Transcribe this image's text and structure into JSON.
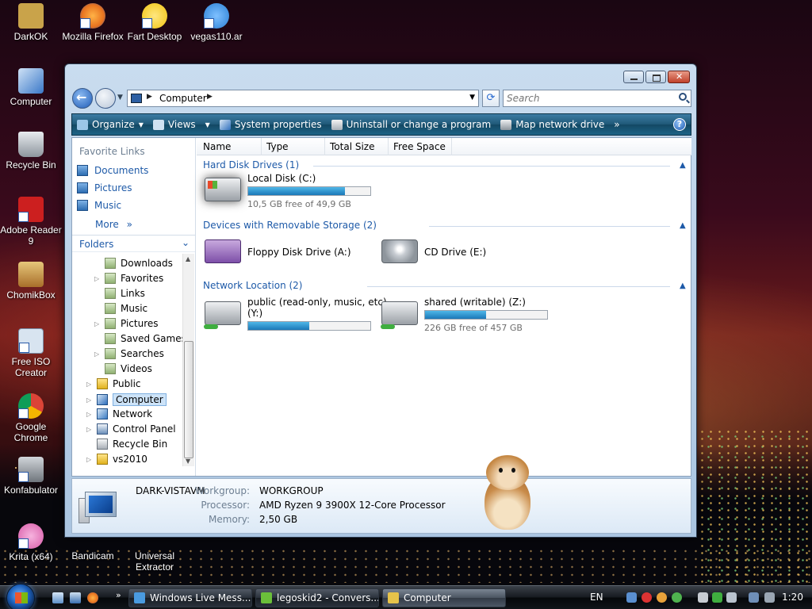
{
  "desktop": {
    "icons": [
      {
        "label": "DarkOK",
        "color": "#c9a34a"
      },
      {
        "label": "Mozilla Firefox",
        "color": "#e8731f"
      },
      {
        "label": "Fart Desktop",
        "color": "#f1c40f"
      },
      {
        "label": "vegas110.ar",
        "color": "#2a7fd4"
      },
      {
        "label": "Computer",
        "color": "#3a78c8"
      },
      {
        "label": "Recycle Bin",
        "color": "#b0b7bf"
      },
      {
        "label": "Adobe Reader 9",
        "color": "#cc1f1f"
      },
      {
        "label": "ChomikBox",
        "color": "#c58a2a"
      },
      {
        "label": "Free ISO Creator",
        "color": "#d8e4f0"
      },
      {
        "label": "Google Chrome",
        "color": "#3b8ae6"
      },
      {
        "label": "Konfabulator",
        "color": "#8a8f96"
      },
      {
        "label": "Krita (x64)",
        "color": "#d85aa8"
      },
      {
        "label": "Bandicam",
        "color": "#2c2c2c"
      },
      {
        "label": "Universal Extractor",
        "color": "#8a5a2a"
      }
    ]
  },
  "window": {
    "address": {
      "location": "Computer"
    },
    "search": {
      "placeholder": "Search"
    },
    "toolbar": {
      "organize": "Organize",
      "views": "Views",
      "system_properties": "System properties",
      "uninstall": "Uninstall or change a program",
      "map_drive": "Map network drive",
      "overflow": "»",
      "help": "?"
    },
    "nav": {
      "favorite_links_header": "Favorite Links",
      "favorites": [
        "Documents",
        "Pictures",
        "Music"
      ],
      "more": "More",
      "more_chevron": "»",
      "folders_header": "Folders",
      "tree": [
        {
          "label": "Downloads",
          "expandable": false
        },
        {
          "label": "Favorites",
          "expandable": true
        },
        {
          "label": "Links",
          "expandable": false
        },
        {
          "label": "Music",
          "expandable": false
        },
        {
          "label": "Pictures",
          "expandable": true
        },
        {
          "label": "Saved Games",
          "expandable": false
        },
        {
          "label": "Searches",
          "expandable": true
        },
        {
          "label": "Videos",
          "expandable": false
        },
        {
          "label": "Public",
          "expandable": true
        },
        {
          "label": "Computer",
          "expandable": true,
          "selected": true
        },
        {
          "label": "Network",
          "expandable": true
        },
        {
          "label": "Control Panel",
          "expandable": true
        },
        {
          "label": "Recycle Bin",
          "expandable": false
        },
        {
          "label": "vs2010",
          "expandable": true
        }
      ]
    },
    "columns": [
      "Name",
      "Type",
      "Total Size",
      "Free Space"
    ],
    "groups": {
      "hard_disks": {
        "title": "Hard Disk Drives (1)",
        "drives": [
          {
            "name": "Local Disk (C:)",
            "free_text": "10,5 GB free of 49,9 GB",
            "used_fraction": 0.79
          }
        ]
      },
      "removable": {
        "title": "Devices with Removable Storage (2)",
        "drives": [
          {
            "name": "Floppy Disk Drive (A:)"
          },
          {
            "name": "CD Drive (E:)"
          }
        ]
      },
      "network": {
        "title": "Network Location (2)",
        "drives": [
          {
            "name_line1": "public (read-only, music, etc)",
            "name_line2": "(Y:)",
            "used_fraction": 0.5
          },
          {
            "name": "shared (writable) (Z:)",
            "free_text": "226 GB free of 457 GB",
            "used_fraction": 0.5
          }
        ]
      }
    },
    "details": {
      "computer_name": "DARK-VISTAVM",
      "workgroup_label": "Workgroup:",
      "workgroup": "WORKGROUP",
      "processor_label": "Processor:",
      "processor": "AMD Ryzen 9 3900X 12-Core Processor",
      "memory_label": "Memory:",
      "memory": "2,50 GB"
    }
  },
  "taskbar": {
    "buttons": [
      {
        "label": "Windows Live Mess...",
        "color": "#4a9be0"
      },
      {
        "label": "legoskid2 - Convers...",
        "color": "#6bbf3a"
      },
      {
        "label": "Computer",
        "color": "#e6c34a",
        "active": true
      }
    ],
    "language": "EN",
    "clock": "1:20"
  }
}
